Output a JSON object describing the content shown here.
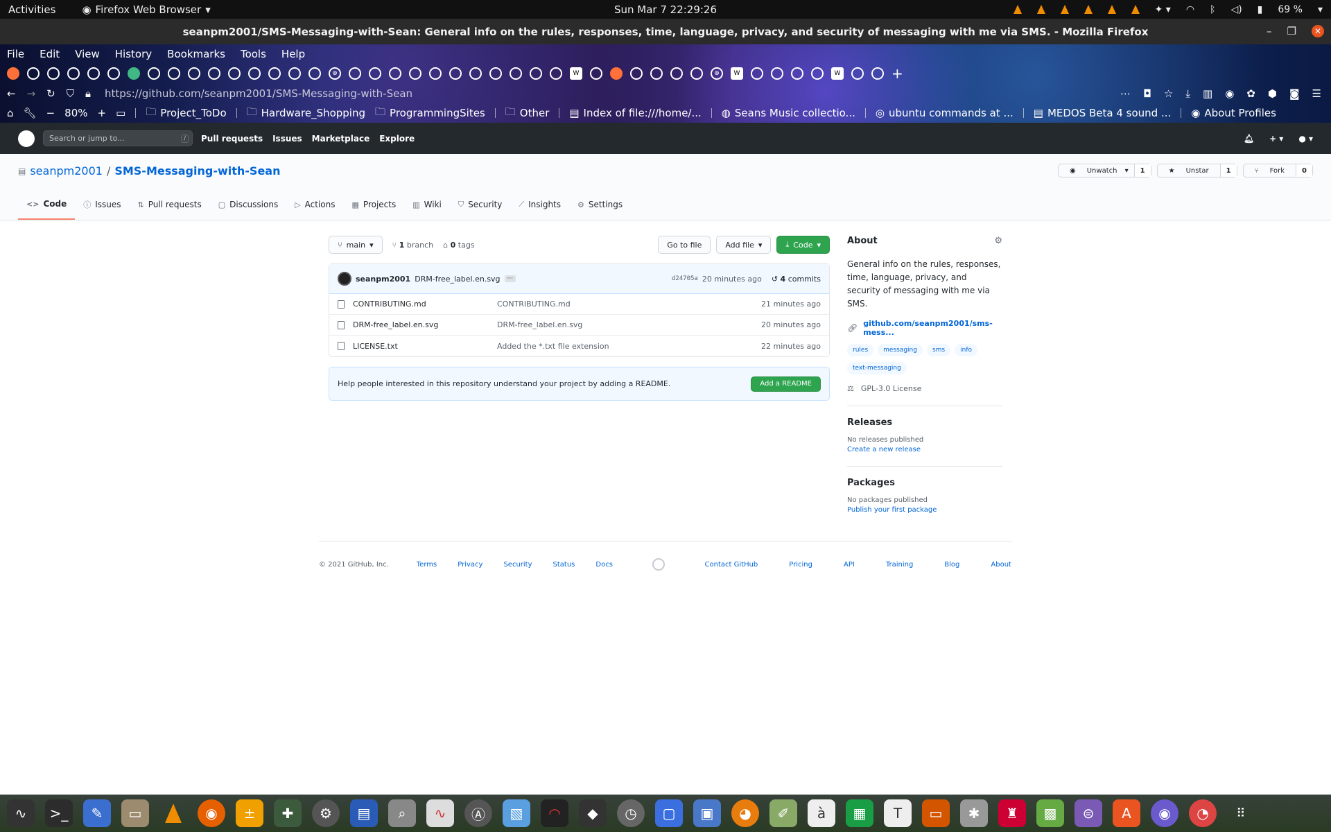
{
  "system": {
    "activities": "Activities",
    "app_name": "Firefox Web Browser",
    "clock": "Sun Mar 7  22:29:26",
    "battery": "69 %"
  },
  "window": {
    "title": "seanpm2001/SMS-Messaging-with-Sean: General info on the rules, responses, time, language, privacy, and security of messaging with me via SMS. - Mozilla Firefox"
  },
  "browser": {
    "menu": [
      "File",
      "Edit",
      "View",
      "History",
      "Bookmarks",
      "Tools",
      "Help"
    ],
    "url": "https://github.com/seanpm2001/SMS-Messaging-with-Sean",
    "zoom": "80%",
    "bookmarks": [
      "Project_ToDo",
      "Hardware_Shopping",
      "ProgrammingSites",
      "Other",
      "Index of file:///home/...",
      "Seans Music collectio...",
      "ubuntu commands at ...",
      "MEDOS Beta 4 sound ...",
      "About Profiles"
    ]
  },
  "github": {
    "search_placeholder": "Search or jump to...",
    "search_key": "/",
    "nav": [
      "Pull requests",
      "Issues",
      "Marketplace",
      "Explore"
    ],
    "owner": "seanpm2001",
    "repo": "SMS-Messaging-with-Sean",
    "sep": "/",
    "watch": {
      "label": "Unwatch",
      "count": "1"
    },
    "star": {
      "label": "Unstar",
      "count": "1"
    },
    "fork": {
      "label": "Fork",
      "count": "0"
    },
    "tabs": [
      "Code",
      "Issues",
      "Pull requests",
      "Discussions",
      "Actions",
      "Projects",
      "Wiki",
      "Security",
      "Insights",
      "Settings"
    ],
    "branch": "main",
    "branch_count": "1",
    "branch_word": "branch",
    "tag_count": "0",
    "tag_word": "tags",
    "go_to_file": "Go to file",
    "add_file": "Add file",
    "code_btn": "Code",
    "commit": {
      "author": "seanpm2001",
      "message": "DRM-free_label.en.svg",
      "sha": "d24705a",
      "time": "20 minutes ago",
      "count": "4",
      "count_word": "commits"
    },
    "files": [
      {
        "name": "CONTRIBUTING.md",
        "msg": "CONTRIBUTING.md",
        "time": "21 minutes ago"
      },
      {
        "name": "DRM-free_label.en.svg",
        "msg": "DRM-free_label.en.svg",
        "time": "20 minutes ago"
      },
      {
        "name": "LICENSE.txt",
        "msg": "Added the *.txt file extension",
        "time": "22 minutes ago"
      }
    ],
    "readme_prompt": "Help people interested in this repository understand your project by adding a README.",
    "readme_btn": "Add a README",
    "about": {
      "title": "About",
      "desc": "General info on the rules, responses, time, language, privacy, and security of messaging with me via SMS.",
      "link": "github.com/seanpm2001/sms-mess...",
      "topics": [
        "rules",
        "messaging",
        "sms",
        "info",
        "text-messaging"
      ],
      "license": "GPL-3.0 License"
    },
    "releases": {
      "title": "Releases",
      "none": "No releases published",
      "create": "Create a new release"
    },
    "packages": {
      "title": "Packages",
      "none": "No packages published",
      "publish": "Publish your first package"
    },
    "footer": {
      "copyright": "© 2021 GitHub, Inc.",
      "left": [
        "Terms",
        "Privacy",
        "Security",
        "Status",
        "Docs"
      ],
      "right": [
        "Contact GitHub",
        "Pricing",
        "API",
        "Training",
        "Blog",
        "About"
      ]
    }
  },
  "colors": {
    "accent": "#0366d6",
    "green": "#2ea44f",
    "tab_underline": "#f9826c"
  }
}
